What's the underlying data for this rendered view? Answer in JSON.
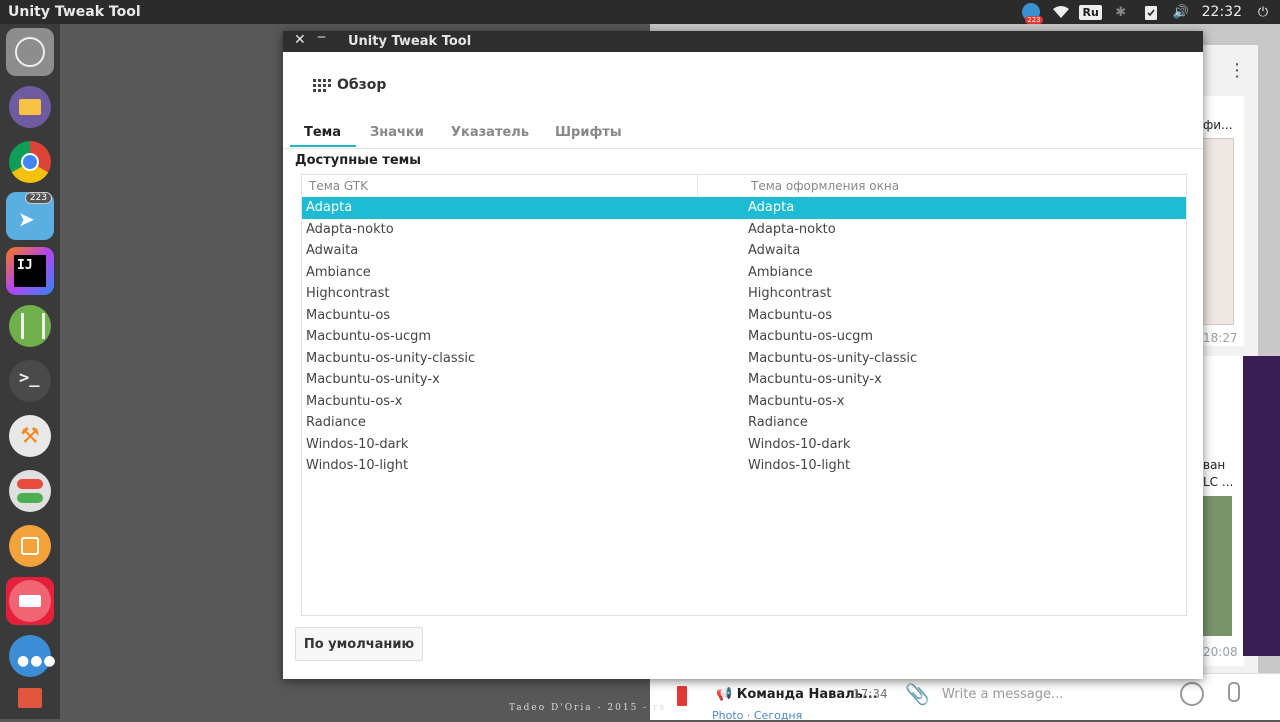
{
  "topbar": {
    "app_title": "Unity Tweak Tool",
    "tray_badge": "223",
    "keyboard_layout": "Ru",
    "clock": "22:32"
  },
  "launcher": {
    "telegram_badge": "223",
    "items": [
      "ubuntu-dash",
      "files",
      "chrome",
      "telegram",
      "intellij",
      "android-studio",
      "terminal",
      "inkscape",
      "unity-tweak-tool",
      "software-center",
      "app-store",
      "more-apps",
      "trash"
    ]
  },
  "window": {
    "title": "Unity Tweak Tool",
    "close_glyph": "✕",
    "minimize_glyph": "‒",
    "overview_label": "Обзор",
    "tabs": [
      {
        "label": "Тема",
        "active": true
      },
      {
        "label": "Значки",
        "active": false
      },
      {
        "label": "Указатель",
        "active": false
      },
      {
        "label": "Шрифты",
        "active": false
      }
    ],
    "section_title": "Доступные темы",
    "columns": {
      "gtk": "Тема GTK",
      "window": "Тема оформления окна"
    },
    "rows": [
      {
        "gtk": "Adapta",
        "window": "Adapta",
        "selected": true
      },
      {
        "gtk": "Adapta-nokto",
        "window": "Adapta-nokto"
      },
      {
        "gtk": "Adwaita",
        "window": "Adwaita"
      },
      {
        "gtk": "Ambiance",
        "window": "Ambiance"
      },
      {
        "gtk": "Highcontrast",
        "window": "Highcontrast"
      },
      {
        "gtk": "Macbuntu-os",
        "window": "Macbuntu-os"
      },
      {
        "gtk": "Macbuntu-os-ucgm",
        "window": "Macbuntu-os-ucgm"
      },
      {
        "gtk": "Macbuntu-os-unity-classic",
        "window": "Macbuntu-os-unity-classic"
      },
      {
        "gtk": "Macbuntu-os-unity-x",
        "window": "Macbuntu-os-unity-x"
      },
      {
        "gtk": "Macbuntu-os-x",
        "window": "Macbuntu-os-x"
      },
      {
        "gtk": "Radiance",
        "window": "Radiance"
      },
      {
        "gtk": "Windos-10-dark",
        "window": "Windos-10-dark"
      },
      {
        "gtk": "Windos-10-light",
        "window": "Windos-10-light"
      }
    ],
    "default_button": "По умолчанию"
  },
  "background": {
    "chat_name": "Команда Наваль...",
    "chat_time": "17:34",
    "chat_sub": "Photo · Сегодня",
    "message_placeholder": "Write a message...",
    "time1": "18:27",
    "time2": "20:08",
    "snippet1": "фи...",
    "snippet2": "ван",
    "snippet3": "LC ...",
    "desktop_caption": "Tadeo D'Oria - 2015 - rs"
  },
  "colors": {
    "accent": "#1cbcd4",
    "panel": "#2b2b2b",
    "launcher": "#3a3a3a"
  }
}
